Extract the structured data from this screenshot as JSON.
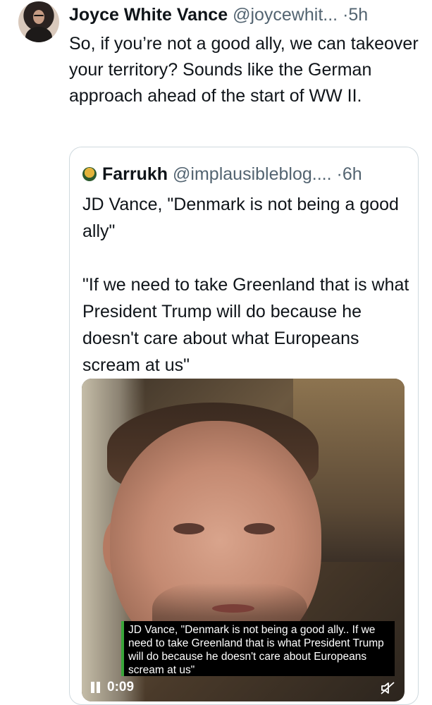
{
  "tweet": {
    "author_name": "Joyce White Vance",
    "author_handle": "@joycewhit...",
    "dot": "·",
    "time": "5h",
    "text": "So, if you’re not a good ally, we can takeover your territory? Sounds like the German approach ahead of the start of WW II."
  },
  "quoted": {
    "author_name": "Farrukh",
    "author_handle": "@implausibleblog....",
    "dot": "·",
    "time": "6h",
    "paragraphs": [
      "JD Vance, \"Denmark is not being a good ally\"",
      "\"If we need to take Greenland that is what President Trump will do because he doesn't care about what Europeans scream at us\""
    ],
    "video": {
      "caption": "JD Vance, \"Denmark is not being a good ally.. If we need to take Greenland that is what President Trump will do because he doesn't care about Europeans scream at us\"",
      "timecode": "0:09",
      "pause_icon": "pause-icon",
      "mute_icon": "muted-speaker-icon"
    }
  }
}
